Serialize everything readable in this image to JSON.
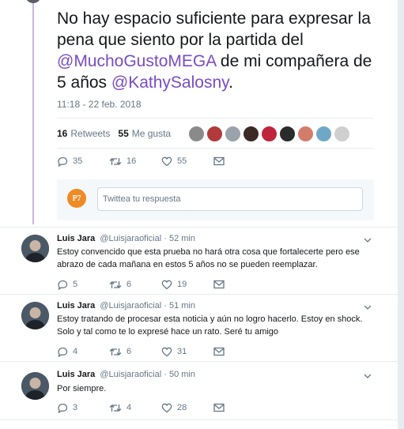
{
  "tweet": {
    "text_before_1": "No hay espacio suficiente para  expresar la pena que siento  por la partida del ",
    "mention_1": "@MuchoGustoMEGA",
    "text_between": " de mi compañera de 5 años ",
    "mention_2": "@KathySalosny",
    "text_after": ".",
    "timestamp": "11:18 - 22 feb. 2018",
    "retweets_count": "16",
    "retweets_label": "Retweets",
    "likes_count": "55",
    "likes_label": "Me gusta",
    "reply_count": "35",
    "retweet_count": "16",
    "like_count": "55"
  },
  "likers": [
    "#8a8a8a",
    "#b23a3a",
    "#9aa3ab",
    "#3b2a25",
    "#c0243b",
    "#2b2b2b",
    "#d47c6a",
    "#6fa8c6",
    "#cfcfcf"
  ],
  "reply_box": {
    "avatar_text": "P7",
    "placeholder": "Twittea tu respuesta"
  },
  "replies": [
    {
      "name": "Luis Jara",
      "handle": "@Luisjaraoficial",
      "time": "· 52 min",
      "text": "Estoy convencido que esta prueba no hará otra cosa que fortalecerte pero ese abrazo de cada mañana en estos 5 años no se pueden reemplazar.",
      "reply_count": "5",
      "retweet_count": "6",
      "like_count": "19"
    },
    {
      "name": "Luis Jara",
      "handle": "@Luisjaraoficial",
      "time": "· 51 min",
      "text": "Estoy tratando de procesar esta noticia y aún no logro hacerlo.  Estoy en shock. Solo y tal como te lo expresé hace un rato. Seré tu amigo",
      "reply_count": "4",
      "retweet_count": "6",
      "like_count": "31"
    },
    {
      "name": "Luis Jara",
      "handle": "@Luisjaraoficial",
      "time": "· 50 min",
      "text": "Por siempre.",
      "reply_count": "3",
      "retweet_count": "4",
      "like_count": "28"
    }
  ],
  "colors": {
    "mention": "#794bc4",
    "thread_line": "#c8b4e6",
    "secondary_text": "#657786"
  }
}
